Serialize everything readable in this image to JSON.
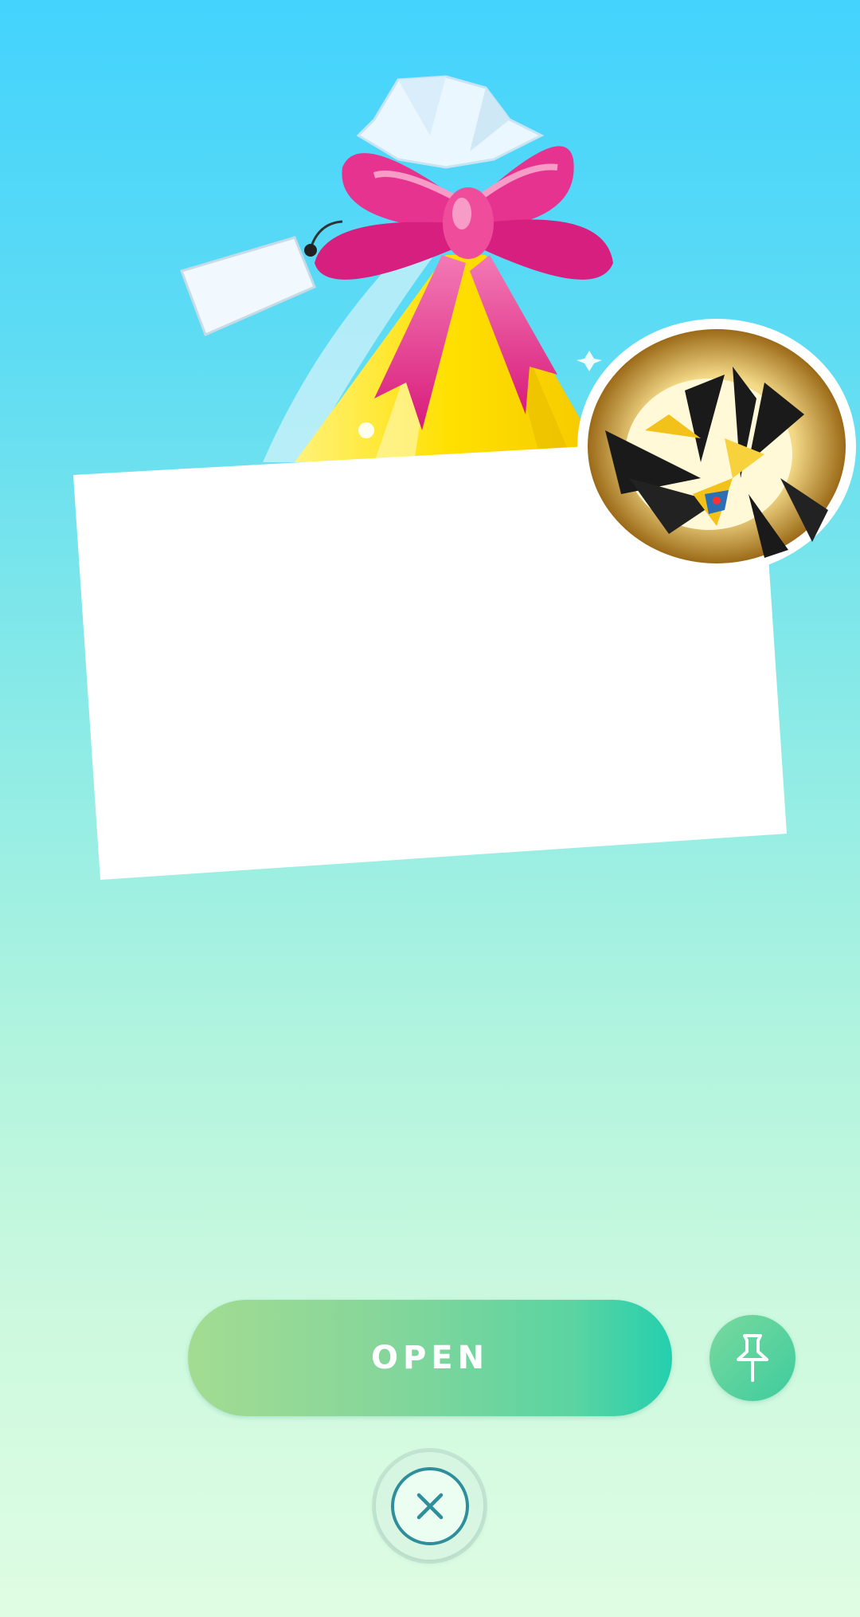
{
  "screen": {
    "name": "gift-open-screen"
  },
  "gift": {
    "icon": "gift-bag-icon",
    "bow_color": "#e6338f",
    "bag_color": "#ffe21a",
    "card_color": "#ffffff"
  },
  "sticker": {
    "icon": "pokemon-sticker-icon"
  },
  "actions": {
    "open_label": "OPEN",
    "open_color_start": "#a3dc92",
    "open_color_end": "#24cfae",
    "pin_icon": "pin-icon",
    "close_icon": "close-icon"
  }
}
